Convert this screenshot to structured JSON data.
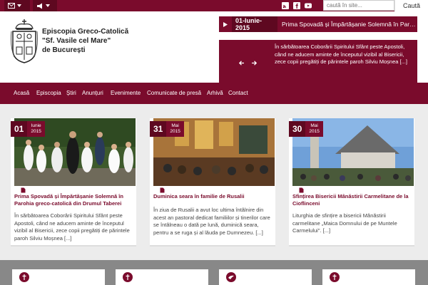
{
  "topbar": {
    "search_placeholder": "caută în site...",
    "search_button": "Caută",
    "icons": [
      "envelope-icon",
      "megaphone-icon",
      "rss-icon",
      "facebook-icon",
      "youtube-icon"
    ]
  },
  "header": {
    "site_name_line1": "Episcopia Greco-Catolică",
    "site_name_line2": "\"Sf. Vasile cel Mare\"",
    "site_name_line3": "de București",
    "ticker_date": "01-Iunie-2015",
    "ticker_text": "Prima Spovadă și Împărtășanie Solemnă în Parohia gre...",
    "slider_text": "În sărbătoarea Coborârii Spiritului Sfânt peste Apostoli, când ne aducem aminte de începutul vizibil al Bisericii, zece copii pregătiți de părintele paroh Silviu Moșnea [...]"
  },
  "nav": {
    "items": [
      "Acasă",
      "Episcopia",
      "Știri",
      "Anunțuri",
      "Evenimente",
      "Comunicate de presă",
      "Arhivă",
      "Contact"
    ]
  },
  "cards": [
    {
      "day": "01",
      "month": "Iunie",
      "year": "2015",
      "title": "Prima Spovadă și Împărtășanie Solemnă în Parohia greco-catolică din Drumul Taberei",
      "excerpt": "În sărbătoarea Coborârii Spiritului Sfânt peste Apostoli, când ne aducem aminte de începutul vizibil al Bisericii, zece copii pregătiți de părintele paroh Silviu Moșnea [...]"
    },
    {
      "day": "31",
      "month": "Mai",
      "year": "2015",
      "title": "Duminica seara în familie de Rusalii",
      "excerpt": "În ziua de Rusalii a avut loc ultima întâlnire din acest an pastoral dedicat familiilor și tinerilor care se întâlneau o dată pe lună, duminică seara, pentru a se ruga și al lăuda pe Dumnezeu. [...]"
    },
    {
      "day": "30",
      "month": "Mai",
      "year": "2015",
      "title": "Sfințirea Bisericii Mânăstirii Carmelitane de la Cioflinceni",
      "excerpt": "Liturghia de sfințire a bisericii Mânăstirii carmelitane „Maica Domnului de pe Muntele Carmelului\". [...]"
    }
  ],
  "colors": {
    "brand": "#7a0b2c",
    "brand_dark": "#5e0820"
  }
}
